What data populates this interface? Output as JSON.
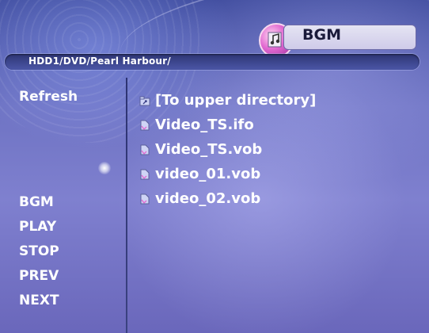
{
  "header": {
    "mode_label": "BGM",
    "mode_icon": "music-note-icon",
    "path": "HDD1/DVD/Pearl Harbour/"
  },
  "sidebar": {
    "items": [
      {
        "label": "Refresh"
      },
      {
        "label": "BGM"
      },
      {
        "label": "PLAY"
      },
      {
        "label": "STOP"
      },
      {
        "label": "PREV"
      },
      {
        "label": "NEXT"
      }
    ]
  },
  "files": {
    "items": [
      {
        "label": "[To upper directory]",
        "icon": "folder-up-icon"
      },
      {
        "label": "Video_TS.ifo",
        "icon": "file-icon"
      },
      {
        "label": "Video_TS.vob",
        "icon": "file-icon"
      },
      {
        "label": "video_01.vob",
        "icon": "file-icon"
      },
      {
        "label": "video_02.vob",
        "icon": "file-icon"
      }
    ]
  },
  "colors": {
    "accent": "#e26ad1",
    "text": "#ffffff",
    "background": "#7f80cf"
  }
}
